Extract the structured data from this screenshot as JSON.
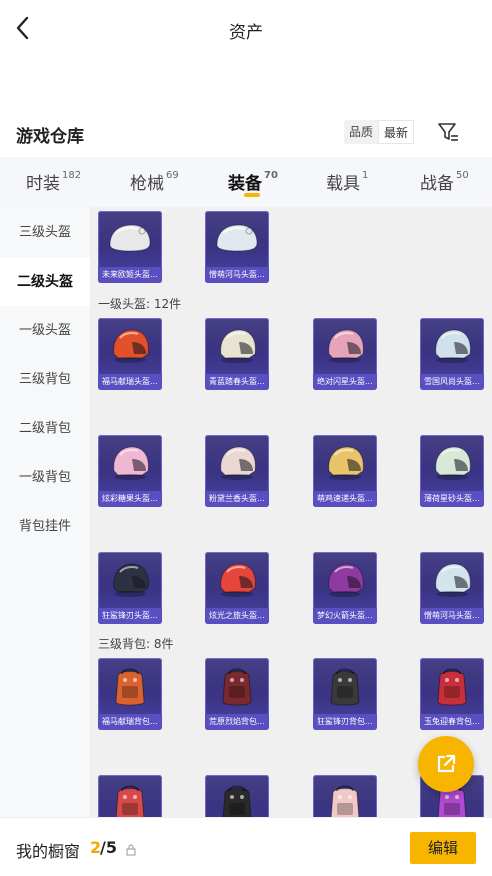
{
  "header": {
    "title": "资产"
  },
  "warehouse": {
    "title": "游戏仓库",
    "sort_options": [
      "品质",
      "最新"
    ],
    "sort_active": "最新"
  },
  "tabs": [
    {
      "label": "时装",
      "count": "182"
    },
    {
      "label": "枪械",
      "count": "69"
    },
    {
      "label": "装备",
      "count": "70",
      "active": true
    },
    {
      "label": "载具",
      "count": "1"
    },
    {
      "label": "战备",
      "count": "50"
    }
  ],
  "sidebar": [
    {
      "label": "三级头盔"
    },
    {
      "label": "二级头盔",
      "active": true
    },
    {
      "label": "一级头盔"
    },
    {
      "label": "三级背包"
    },
    {
      "label": "二级背包"
    },
    {
      "label": "一级背包"
    },
    {
      "label": "背包挂件"
    }
  ],
  "sections": [
    {
      "label": "一级头盔: 12件"
    },
    {
      "label": "三级背包: 8件"
    }
  ],
  "items": [
    {
      "name": "未来欧姬头盔...",
      "type": "helmet2",
      "color": "#e8e8e8"
    },
    {
      "name": "憎萌河马头盔...",
      "type": "helmet2",
      "color": "#dfe9ef"
    },
    {
      "name": "福马献瑞头盔...",
      "type": "helmet",
      "color": "#e2512c"
    },
    {
      "name": "青蓝踏春头盔...",
      "type": "helmet",
      "color": "#e9e4d2"
    },
    {
      "name": "绝对闪星头盔...",
      "type": "helmet",
      "color": "#e6a4b8"
    },
    {
      "name": "雪国风尚头盔...",
      "type": "helmet",
      "color": "#cfe1ea"
    },
    {
      "name": "炫彩糖果头盔...",
      "type": "helmet",
      "color": "#f0b7d2"
    },
    {
      "name": "粉黛兰香头盔...",
      "type": "helmet",
      "color": "#ead7d4"
    },
    {
      "name": "萌鸡速递头盔...",
      "type": "helmet",
      "color": "#e9c46a"
    },
    {
      "name": "薄荷星砂头盔...",
      "type": "helmet",
      "color": "#d8e8d8"
    },
    {
      "name": "狂鲨锋刃头盔...",
      "type": "helmet",
      "color": "#2d3142"
    },
    {
      "name": "炫光之旅头盔...",
      "type": "helmet",
      "color": "#e5463b"
    },
    {
      "name": "梦幻火箭头盔...",
      "type": "helmet",
      "color": "#8f3aa0"
    },
    {
      "name": "憎萌河马头盔...",
      "type": "helmet",
      "color": "#d3e4ec"
    },
    {
      "name": "福马献瑞背包...",
      "type": "bag",
      "color": "#d9622f"
    },
    {
      "name": "荒原烈焰背包...",
      "type": "bag",
      "color": "#7a2a2e"
    },
    {
      "name": "狂鲨锋刃背包...",
      "type": "bag",
      "color": "#3a3a3a"
    },
    {
      "name": "玉兔迎春背包...",
      "type": "bag",
      "color": "#c7303a"
    },
    {
      "name": "",
      "type": "bag",
      "color": "#d64a4a"
    },
    {
      "name": "",
      "type": "bag",
      "color": "#2a2a2a"
    },
    {
      "name": "",
      "type": "bag",
      "color": "#f0c8c8"
    },
    {
      "name": "",
      "type": "bag",
      "color": "#b04ad0"
    }
  ],
  "footer": {
    "label": "我的橱窗",
    "current": "2",
    "separator_total": "/5",
    "edit_label": "编辑"
  },
  "colors": {
    "accent": "#f7b500",
    "card_bg": "#3d3689",
    "card_label": "#5a4fc0"
  }
}
